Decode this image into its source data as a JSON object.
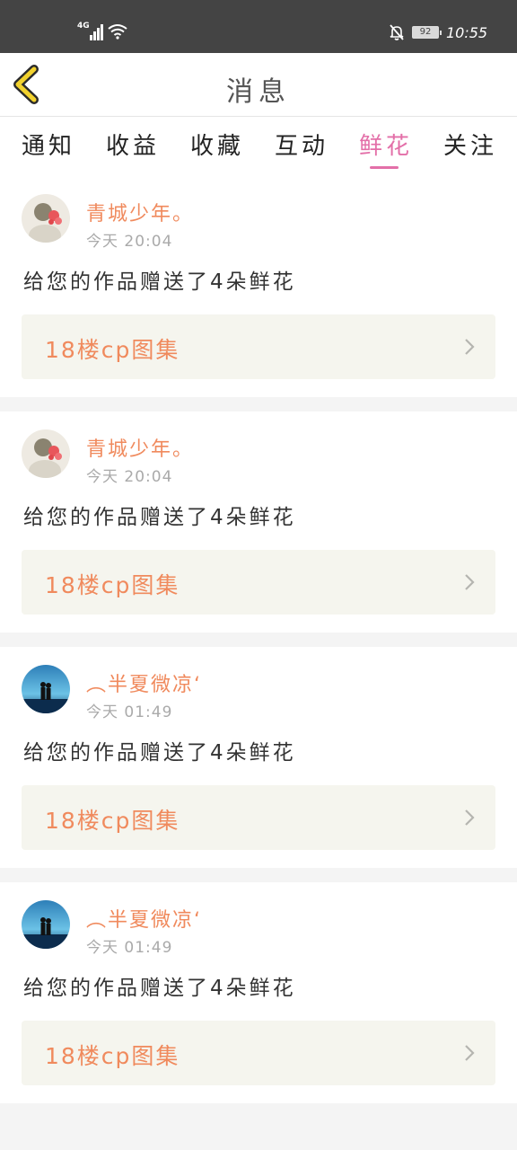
{
  "status_bar": {
    "network": "4G",
    "battery": "92",
    "time": "10:55"
  },
  "header": {
    "title": "消息",
    "back_icon": "back-chevron-icon"
  },
  "tabs": [
    {
      "label": "通知",
      "active": false
    },
    {
      "label": "收益",
      "active": false
    },
    {
      "label": "收藏",
      "active": false
    },
    {
      "label": "互动",
      "active": false
    },
    {
      "label": "鲜花",
      "active": true
    },
    {
      "label": "关注",
      "active": false
    }
  ],
  "colors": {
    "accent_pink": "#e36fa8",
    "orange_text": "#f08a5d",
    "status_bar": "#444444"
  },
  "messages": [
    {
      "user": "青城少年。",
      "time": "今天  20:04",
      "text": "给您的作品赠送了4朵鲜花",
      "work": "18楼cp图集"
    },
    {
      "user": "青城少年。",
      "time": "今天  20:04",
      "text": "给您的作品赠送了4朵鲜花",
      "work": "18楼cp图集"
    },
    {
      "user": "︵半夏微凉‘",
      "time": "今天  01:49",
      "text": "给您的作品赠送了4朵鲜花",
      "work": "18楼cp图集"
    },
    {
      "user": "︵半夏微凉‘",
      "time": "今天  01:49",
      "text": "给您的作品赠送了4朵鲜花",
      "work": "18楼cp图集"
    }
  ]
}
